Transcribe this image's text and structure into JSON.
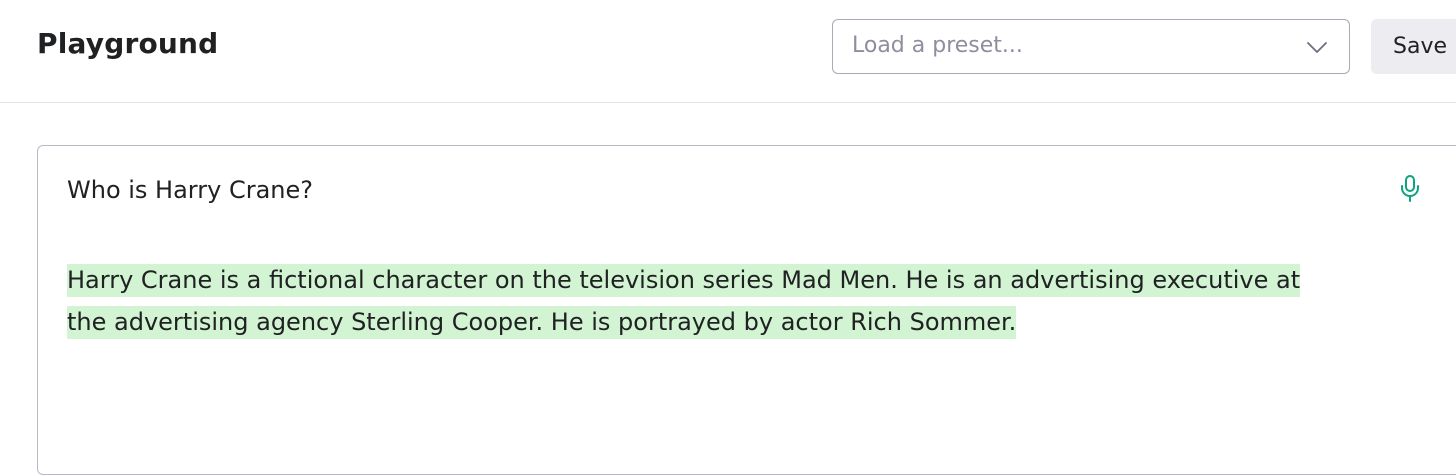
{
  "header": {
    "title": "Playground",
    "preset_placeholder": "Load a preset...",
    "save_label": "Save"
  },
  "editor": {
    "prompt": "Who is Harry Crane?",
    "completion_lines": [
      "Harry Crane is a fictional character on the television series Mad Men. He is an advertising executive at",
      "the advertising agency Sterling Cooper. He is portrayed by actor Rich Sommer."
    ]
  },
  "colors": {
    "completion_highlight": "#d2f4d3",
    "mic_accent": "#10a37f"
  },
  "icons": {
    "dropdown": "chevron-down-icon",
    "voice": "microphone-icon"
  }
}
